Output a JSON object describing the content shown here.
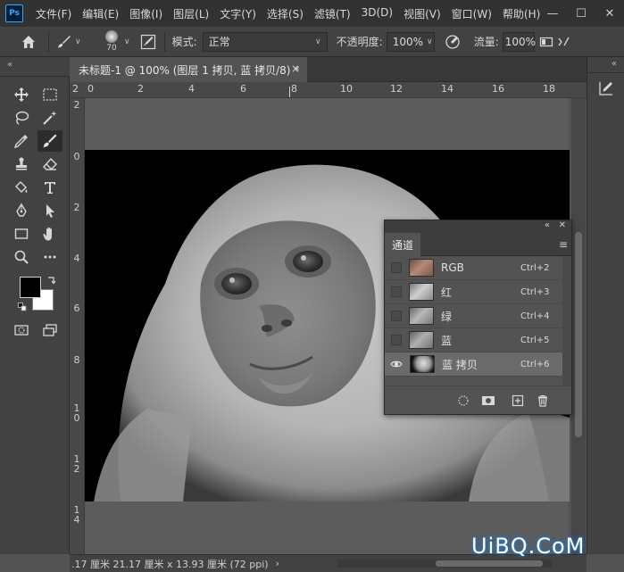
{
  "app": {
    "logo": "Ps"
  },
  "menu": [
    "文件(F)",
    "编辑(E)",
    "图像(I)",
    "图层(L)",
    "文字(Y)",
    "选择(S)",
    "滤镜(T)",
    "3D(D)",
    "视图(V)",
    "窗口(W)",
    "帮助(H)"
  ],
  "window_controls": {
    "minimize": "—",
    "maximize": "☐",
    "close": "✕"
  },
  "options": {
    "brush_size": "70",
    "mode_label": "模式:",
    "mode_value": "正常",
    "opacity_label": "不透明度:",
    "opacity_value": "100%",
    "flow_label": "流量:",
    "flow_value": "100%"
  },
  "panel_collapse": "«",
  "document": {
    "tab_title": "未标题-1 @ 100% (图层 1 拷贝, 蓝 拷贝/8) *",
    "close": "×"
  },
  "ruler_top": [
    "2",
    "0",
    "2",
    "4",
    "6",
    "8",
    "10",
    "12",
    "14",
    "16",
    "18"
  ],
  "ruler_left": [
    "2",
    "0",
    "2",
    "4",
    "6",
    "8",
    "1\n0",
    "1\n2",
    "1\n4"
  ],
  "status": {
    "text": ".17 厘米   21.17 厘米 x 13.93 厘米 (72 ppi)",
    "arrow": "›"
  },
  "channels_panel": {
    "top_collapse": "«",
    "top_close": "✕",
    "tab": "通道",
    "menu_icon": "≡",
    "rows": [
      {
        "name": "RGB",
        "shortcut": "Ctrl+2",
        "visible": false,
        "selected": false,
        "thumb": "color"
      },
      {
        "name": "红",
        "shortcut": "Ctrl+3",
        "visible": false,
        "selected": false,
        "thumb": "gray-light"
      },
      {
        "name": "绿",
        "shortcut": "Ctrl+4",
        "visible": false,
        "selected": false,
        "thumb": "gray"
      },
      {
        "name": "蓝",
        "shortcut": "Ctrl+5",
        "visible": false,
        "selected": false,
        "thumb": "gray"
      },
      {
        "name": "蓝 拷贝",
        "shortcut": "Ctrl+6",
        "visible": true,
        "selected": true,
        "thumb": "bw"
      }
    ]
  },
  "watermark": "UiBQ.CoM",
  "colors": {
    "foreground": "#000000",
    "background": "#ffffff",
    "accent": "#31a8ff"
  }
}
